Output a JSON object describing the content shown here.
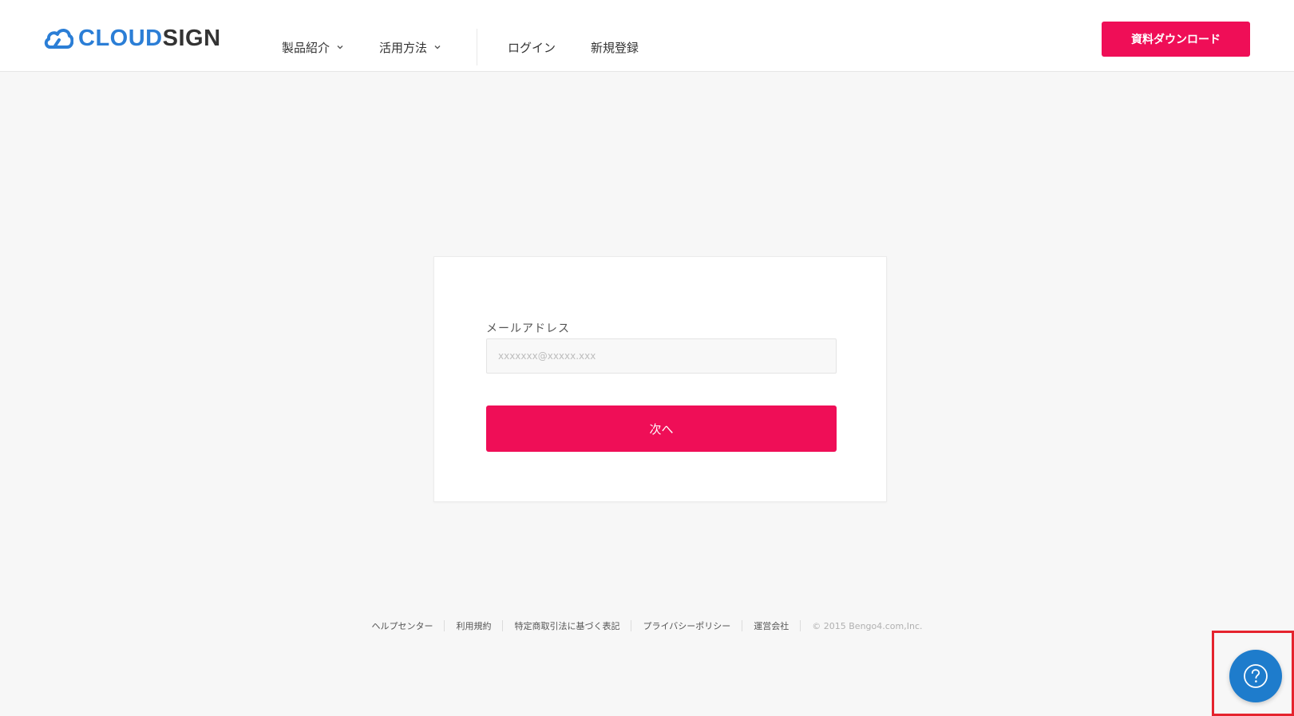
{
  "header": {
    "logo": {
      "part1": "CLOUD",
      "part2": "SIGN"
    },
    "nav": {
      "products": "製品紹介",
      "usage": "活用方法",
      "login": "ログイン",
      "signup": "新規登録"
    },
    "cta_label": "資料ダウンロード"
  },
  "form": {
    "email_label": "メールアドレス",
    "email_placeholder": "xxxxxxx@xxxxx.xxx",
    "email_value": "",
    "next_label": "次へ"
  },
  "footer": {
    "links": [
      "ヘルプセンター",
      "利用規約",
      "特定商取引法に基づく表記",
      "プライバシーポリシー",
      "運営会社"
    ],
    "copyright": "© 2015 Bengo4.com,Inc."
  },
  "colors": {
    "accent": "#ef0e57",
    "brand_blue": "#2b7ed6",
    "help_button": "#1e7ccc",
    "highlight": "#e5232e",
    "background": "#f7f7f7"
  },
  "icons": {
    "logo": "cloud-sign-logo-icon",
    "nav_chevron": "chevron-down-icon",
    "help": "question-mark-icon"
  }
}
